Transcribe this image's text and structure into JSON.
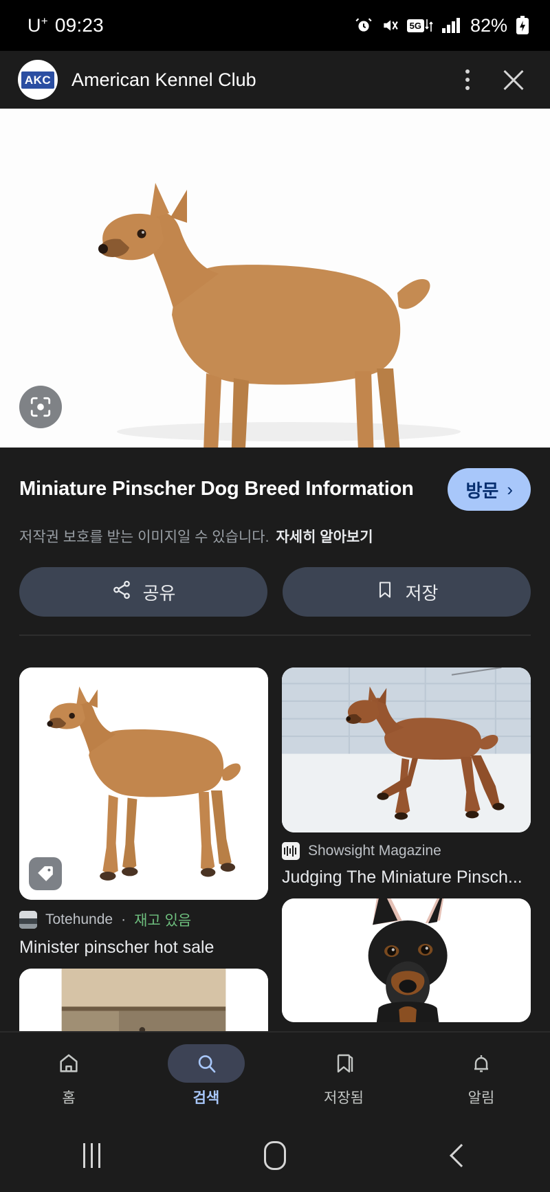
{
  "statusbar": {
    "carrier": "U",
    "carrier_sup": "+",
    "time": "09:23",
    "battery": "82%",
    "network": "5G",
    "icons": [
      "alarm-icon",
      "mute-icon",
      "5g-icon",
      "signal-icon",
      "battery-icon"
    ]
  },
  "appbar": {
    "logo_text": "AKC",
    "title": "American Kennel Club",
    "menu_icon": "kebab-menu-icon",
    "close_icon": "close-icon"
  },
  "hero": {
    "lens_icon": "google-lens-icon",
    "alt": "Miniature Pinscher standing in profile on white background"
  },
  "info": {
    "title": "Miniature Pinscher Dog Breed Information",
    "visit_label": "방문",
    "visit_chevron": "›",
    "copyright_text": "저작권 보호를 받는 이미지일 수 있습니다.",
    "learn_more": "자세히 알아보기",
    "share_label": "공유",
    "save_label": "저장",
    "share_icon": "share-icon",
    "save_icon": "bookmark-icon",
    "visit_pill_color": "#a8c7fa",
    "action_bg_color": "#3c4453"
  },
  "results": {
    "left": [
      {
        "source": "Totehunde",
        "separator": "·",
        "stock": "재고 있음",
        "stock_color": "#6ebf7e",
        "title": "Minister pinscher hot sale",
        "badge_icon": "price-tag-icon",
        "favicon": "totehunde-favicon"
      },
      {
        "source": "",
        "separator": "",
        "stock": "",
        "title": "",
        "favicon": ""
      }
    ],
    "right": [
      {
        "source": "Showsight Magazine",
        "separator": "",
        "stock": "",
        "title": "Judging The Miniature Pinsch...",
        "favicon": "showsight-favicon"
      },
      {
        "source": "",
        "separator": "",
        "stock": "",
        "title": "",
        "favicon": ""
      }
    ]
  },
  "bottomnav": {
    "items": [
      {
        "label": "홈",
        "icon": "home-icon",
        "active": false
      },
      {
        "label": "검색",
        "icon": "search-icon",
        "active": true
      },
      {
        "label": "저장됨",
        "icon": "bookmark-icon",
        "active": false
      },
      {
        "label": "알림",
        "icon": "bell-icon",
        "active": false
      }
    ],
    "active_color": "#a8c7fa"
  },
  "sysnav": {
    "recents_icon": "recents-icon",
    "home_icon": "home-pill-icon",
    "back_icon": "back-chevron-icon"
  }
}
